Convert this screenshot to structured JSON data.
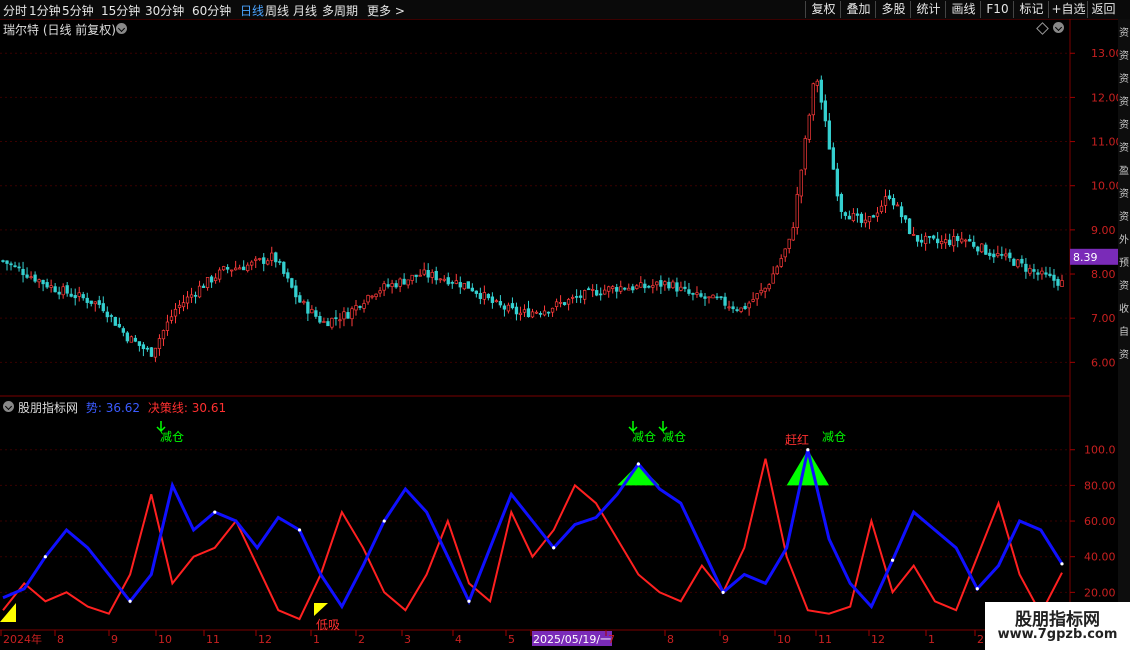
{
  "toolbar": {
    "periods": [
      "分时",
      "1分钟",
      "5分钟",
      "15分钟",
      "30分钟",
      "60分钟",
      "日线",
      "周线",
      "月线",
      "多周期",
      "更多 >"
    ],
    "active_period": "日线",
    "tools": [
      "复权",
      "叠加",
      "多股",
      "统计",
      "画线",
      "F10",
      "标记",
      "+自选",
      "返回"
    ]
  },
  "price_panel": {
    "title": "瑞尔特 (日线 前复权)",
    "y_ticks": [
      "13.00",
      "12.00",
      "11.00",
      "10.00",
      "9.00",
      "8.00",
      "7.00",
      "6.00"
    ],
    "current_price": "8.39",
    "colors": {
      "up": "#ff3b3b",
      "down": "#35d0d0",
      "grid": "#3a0000"
    }
  },
  "indicator_panel": {
    "name": "股朋指标网",
    "line1_label": "势: 36.62",
    "line2_label": "决策线: 30.61",
    "y_ticks": [
      "100.0",
      "80.00",
      "60.00",
      "40.00",
      "20.00"
    ],
    "colors": {
      "line1": "#1010ff",
      "line2": "#ff2020",
      "fill": "#00ff00",
      "low_fill": "#ffff00"
    },
    "annotations": [
      {
        "id": "reduce1",
        "text": "减仓",
        "color": "#00ff00"
      },
      {
        "id": "reduce2",
        "text": "减仓",
        "color": "#00ff00"
      },
      {
        "id": "reduce3",
        "text": "减仓",
        "color": "#00ff00"
      },
      {
        "id": "run",
        "text": "赶红",
        "color": "#ff3030"
      },
      {
        "id": "reduce4",
        "text": "减仓",
        "color": "#00ff00"
      },
      {
        "id": "low",
        "text": "低吸",
        "color": "#ff3030"
      }
    ]
  },
  "x_axis": {
    "labels": [
      "2024年",
      "8",
      "9",
      "10",
      "11",
      "12",
      "1",
      "2",
      "3",
      "4",
      "5",
      "2025/05/19/一",
      "7",
      "8",
      "9",
      "10",
      "11",
      "12",
      "1",
      "2"
    ],
    "highlight": "2025/05/19/一"
  },
  "sidebar_chars": [
    "资",
    "资",
    "资",
    "资",
    "资",
    "资",
    "盈",
    "资",
    "资",
    "外",
    "预",
    "资",
    "收",
    "自",
    "资"
  ],
  "watermark": {
    "title": "股朋指标网",
    "url": "www.7gpzb.com"
  },
  "chart_data": [
    {
      "type": "candlestick",
      "title": "瑞尔特 (日线 前复权)",
      "ylim": [
        5.6,
        13.3
      ],
      "last_close": 8.39,
      "approx_close_path": [
        8.3,
        8.0,
        7.7,
        7.5,
        7.3,
        6.6,
        6.2,
        7.2,
        7.7,
        8.1,
        8.2,
        8.4,
        7.4,
        6.9,
        7.1,
        7.6,
        7.8,
        8.0,
        7.9,
        7.7,
        7.3,
        7.1,
        7.2,
        7.4,
        7.6,
        7.7,
        7.7,
        7.8,
        7.5,
        7.4,
        7.2,
        7.7,
        8.8,
        12.6,
        9.5,
        9.1,
        9.8,
        8.8,
        8.7,
        8.8,
        8.5,
        8.3,
        8.0,
        7.8
      ]
    },
    {
      "type": "line",
      "title": "股朋指标网",
      "ylim": [
        0,
        115
      ],
      "series": [
        {
          "name": "势",
          "last": 36.62,
          "values": [
            17,
            22,
            40,
            55,
            45,
            30,
            15,
            30,
            80,
            55,
            65,
            60,
            45,
            62,
            55,
            30,
            12,
            35,
            60,
            78,
            65,
            40,
            15,
            45,
            75,
            60,
            45,
            58,
            62,
            75,
            92,
            78,
            70,
            45,
            20,
            30,
            25,
            45,
            100,
            50,
            25,
            12,
            38,
            65,
            55,
            45,
            22,
            35,
            60,
            55,
            36
          ]
        },
        {
          "name": "决策线",
          "last": 30.61,
          "values": [
            10,
            25,
            15,
            20,
            12,
            8,
            30,
            75,
            25,
            40,
            45,
            60,
            35,
            10,
            5,
            30,
            65,
            45,
            20,
            10,
            30,
            60,
            25,
            15,
            65,
            40,
            55,
            80,
            70,
            50,
            30,
            20,
            15,
            35,
            20,
            45,
            95,
            40,
            10,
            8,
            12,
            60,
            20,
            35,
            15,
            10,
            40,
            70,
            30,
            8,
            31
          ]
        }
      ]
    }
  ]
}
